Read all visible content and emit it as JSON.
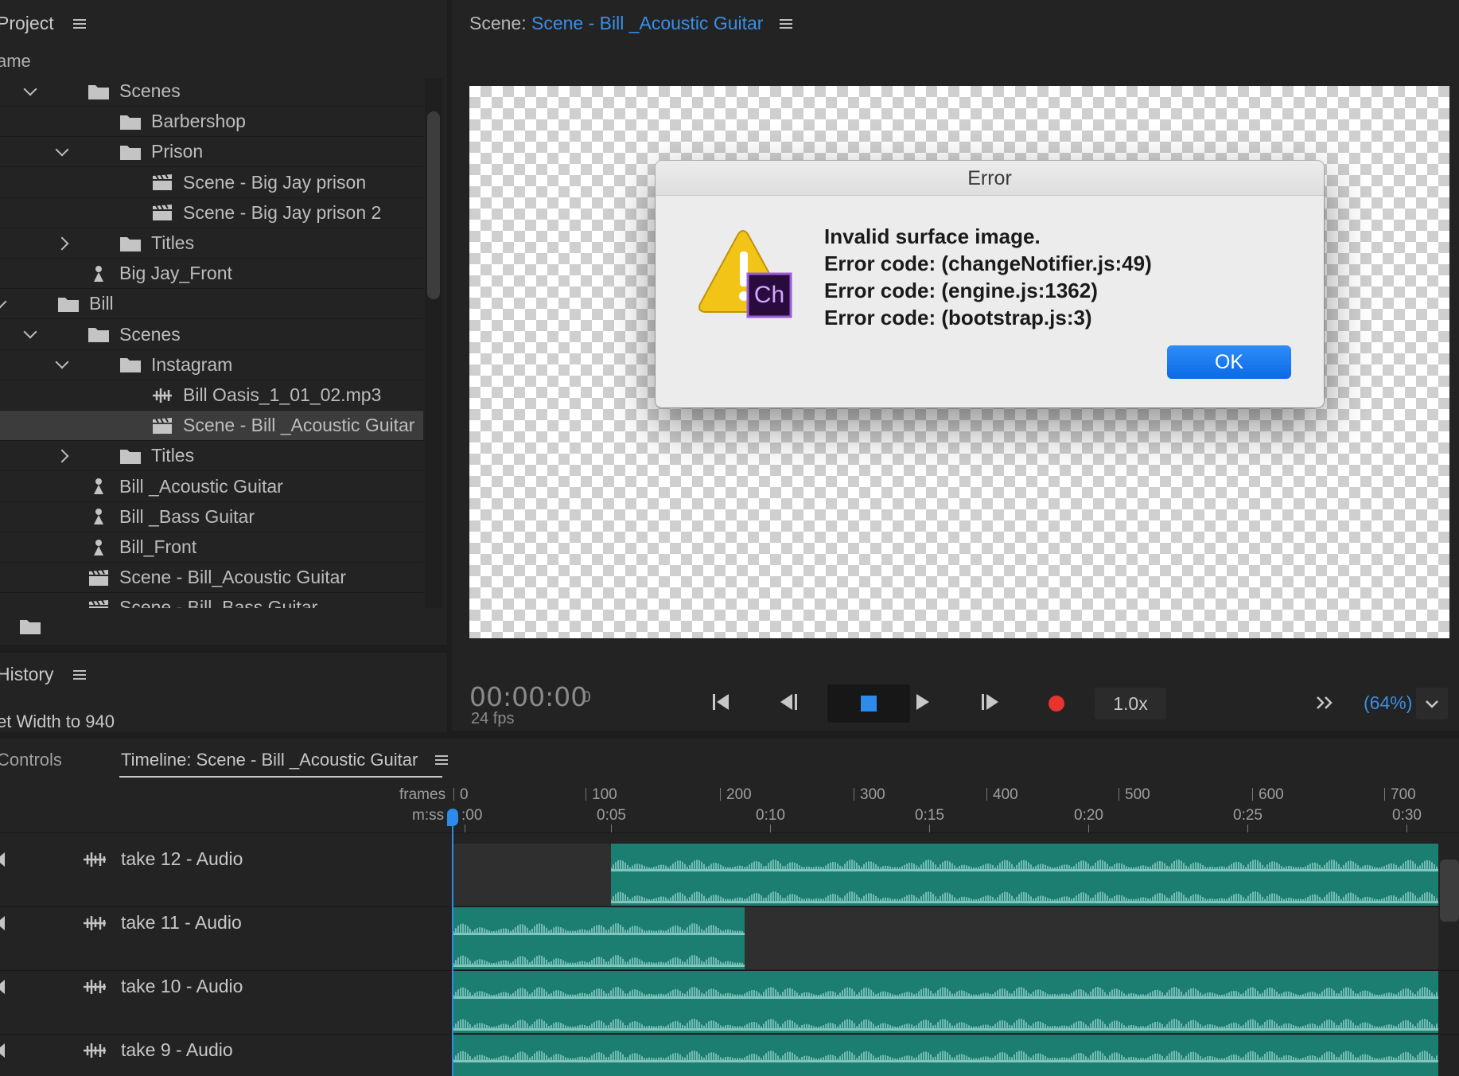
{
  "project": {
    "title": "Project",
    "column_name": "ame",
    "items": [
      {
        "label": "Scenes",
        "type": "folder",
        "expand": "down"
      },
      {
        "label": "Barbershop",
        "type": "folder",
        "expand": ""
      },
      {
        "label": "Prison",
        "type": "folder",
        "expand": "down"
      },
      {
        "label": "Scene - Big Jay prison",
        "type": "scene",
        "expand": ""
      },
      {
        "label": "Scene - Big Jay prison 2",
        "type": "scene",
        "expand": ""
      },
      {
        "label": "Titles",
        "type": "folder",
        "expand": "right"
      },
      {
        "label": "Big Jay_Front",
        "type": "puppet",
        "expand": ""
      },
      {
        "label": "Bill",
        "type": "folder",
        "expand": "down"
      },
      {
        "label": "Scenes",
        "type": "folder",
        "expand": "down"
      },
      {
        "label": "Instagram",
        "type": "folder",
        "expand": "down"
      },
      {
        "label": "Bill Oasis_1_01_02.mp3",
        "type": "audio",
        "expand": ""
      },
      {
        "label": "Scene - Bill _Acoustic Guitar",
        "type": "scene",
        "expand": "",
        "selected": true
      },
      {
        "label": "Titles",
        "type": "folder",
        "expand": "right"
      },
      {
        "label": "Bill _Acoustic Guitar",
        "type": "puppet",
        "expand": ""
      },
      {
        "label": "Bill _Bass Guitar",
        "type": "puppet",
        "expand": ""
      },
      {
        "label": "Bill_Front",
        "type": "puppet",
        "expand": ""
      },
      {
        "label": "Scene - Bill_Acoustic Guitar",
        "type": "scene",
        "expand": ""
      },
      {
        "label": "Scene - Bill_Bass Guitar",
        "type": "scene",
        "expand": ""
      }
    ]
  },
  "history": {
    "title": "History",
    "last_item": "et Width to 940"
  },
  "scene": {
    "prefix": "Scene:",
    "name": "Scene - Bill _Acoustic Guitar"
  },
  "dialog": {
    "title": "Error",
    "lines": [
      "Invalid surface image.",
      "Error code: (changeNotifier.js:49)",
      "Error code: (engine.js:1362)",
      "Error code: (bootstrap.js:3)"
    ],
    "ok_label": "OK",
    "badge": "Ch"
  },
  "transport": {
    "timecode": "00:00:00",
    "frame": "0",
    "fps": "24 fps",
    "speed": "1.0x",
    "zoom": "(64%)"
  },
  "timeline": {
    "controls_tab": "Controls",
    "tab_label": "Timeline: Scene - Bill _Acoustic Guitar",
    "frames_label": "frames",
    "mss_label": "m:ss",
    "frame_ticks": [
      "0",
      "100",
      "200",
      "300",
      "400",
      "500",
      "600",
      "700"
    ],
    "time_ticks": [
      ":00",
      "0:05",
      "0:10",
      "0:15",
      "0:20",
      "0:25",
      "0:30"
    ],
    "tracks": [
      {
        "name": "take 12 - Audio"
      },
      {
        "name": "take 11 - Audio"
      },
      {
        "name": "take 10 - Audio"
      },
      {
        "name": "take 9 - Audio"
      }
    ]
  },
  "colors": {
    "accent": "#2d8ceb",
    "audio_clip": "#1c7d71",
    "record": "#e8332e"
  }
}
